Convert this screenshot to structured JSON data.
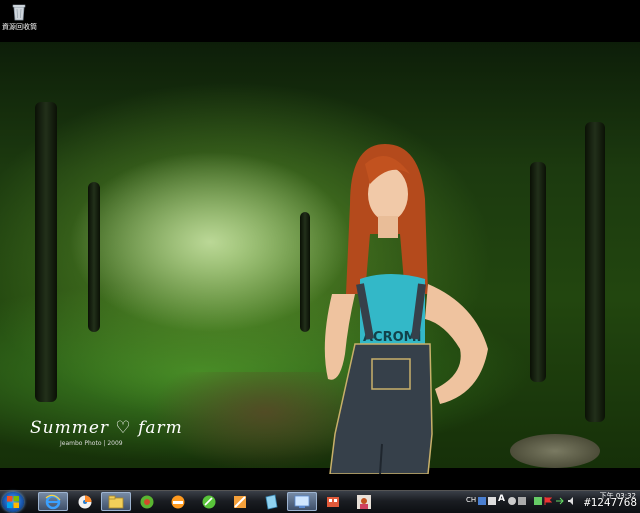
{
  "desktop": {
    "recycle_bin_label": "資源回收筒"
  },
  "wallpaper": {
    "title": "Summer ♡ farm",
    "credit": "Jeambo Photo | 2009",
    "shirt_text": "ACROMI"
  },
  "taskbar": {
    "pinned": [
      {
        "name": "internet-explorer-icon"
      },
      {
        "name": "media-player-icon"
      },
      {
        "name": "file-explorer-icon"
      },
      {
        "name": "green-orb-icon"
      },
      {
        "name": "orange-face-icon"
      },
      {
        "name": "green-ball-icon"
      },
      {
        "name": "paint-icon"
      },
      {
        "name": "notepad-icon"
      },
      {
        "name": "remote-desktop-icon"
      },
      {
        "name": "media-center-icon"
      },
      {
        "name": "profile-photo-icon"
      }
    ],
    "tray": {
      "language": "CH",
      "clock_time": "下午 03:32",
      "watermark": "#1247768"
    }
  }
}
